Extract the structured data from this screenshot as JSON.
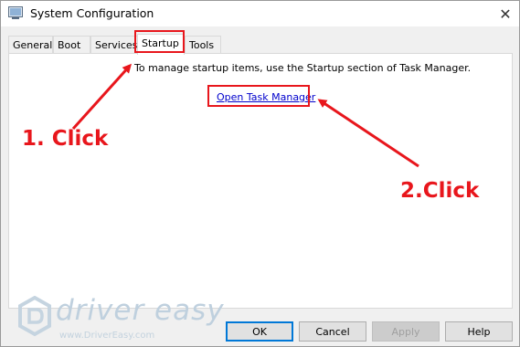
{
  "window": {
    "title": "System Configuration",
    "close_glyph": "✕"
  },
  "tabs": [
    {
      "label": "General",
      "active": false
    },
    {
      "label": "Boot",
      "active": false
    },
    {
      "label": "Services",
      "active": false
    },
    {
      "label": "Startup",
      "active": true
    },
    {
      "label": "Tools",
      "active": false
    }
  ],
  "startup": {
    "message": "To manage startup items, use the Startup section of Task Manager.",
    "link_label": "Open Task Manager"
  },
  "annotations": {
    "step1": "1. Click",
    "step2": "2.Click",
    "color": "#e8161c"
  },
  "buttons": {
    "ok": "OK",
    "cancel": "Cancel",
    "apply": "Apply",
    "help": "Help"
  },
  "watermark": {
    "name": "driver easy",
    "url": "www.DriverEasy.com"
  },
  "icons": {
    "app": "system-config-icon",
    "close": "close-icon",
    "watermark_logo": "drivereasy-logo-icon"
  }
}
